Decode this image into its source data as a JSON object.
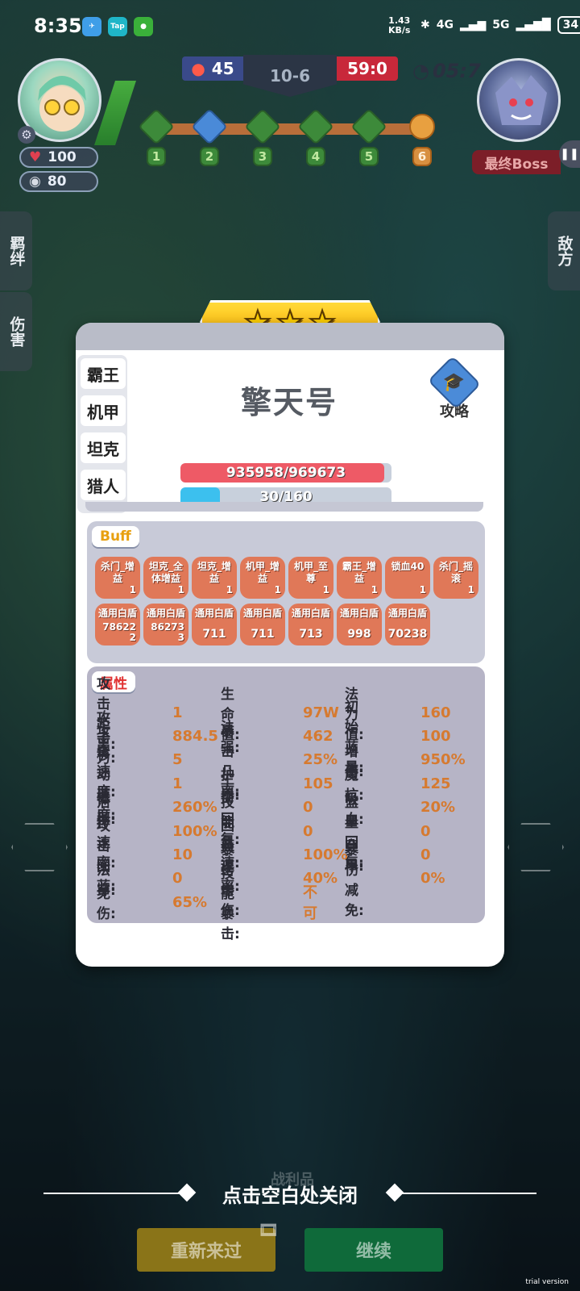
{
  "status_bar": {
    "time": "8:35",
    "net_speed_value": "1.43",
    "net_speed_unit": "KB/s",
    "signal_1": "4G",
    "signal_2": "5G",
    "battery": "34",
    "apps": [
      "telegram-icon",
      "taptap-icon",
      "green-app-icon"
    ]
  },
  "hud": {
    "player": {
      "hp": "100",
      "gold": "80"
    },
    "score_left": "45",
    "level": "10-6",
    "score_right": "59:0",
    "timer": "05:7",
    "stages": [
      "1",
      "2",
      "3",
      "4",
      "5",
      "6"
    ],
    "boss_label": "最终Boss",
    "side_left": [
      "羁绊",
      "伤害"
    ],
    "side_right": "敌方"
  },
  "panel": {
    "stars": 3,
    "tags": [
      "霸王",
      "机甲",
      "坦克",
      "猎人"
    ],
    "name": "擎天号",
    "guide_label": "攻略",
    "hp": {
      "text": "935958/969673",
      "fraction": 0.965,
      "color": "#ee5a66"
    },
    "mana": {
      "text": "30/160",
      "fraction": 0.1875,
      "color": "#3cc0ee"
    },
    "buff_title": "Buff",
    "buffs": [
      {
        "name": "杀门_增益",
        "count": "1"
      },
      {
        "name": "坦克_全体增益",
        "count": "1"
      },
      {
        "name": "坦克_增益",
        "count": "1"
      },
      {
        "name": "机甲_增益",
        "count": "1"
      },
      {
        "name": "机甲_至尊",
        "count": "1"
      },
      {
        "name": "霸王_增益",
        "count": "1"
      },
      {
        "name": "锁血40",
        "count": "1"
      },
      {
        "name": "杀门_摇滚",
        "count": "1"
      },
      {
        "name": "通用白盾",
        "count": "78622\n2"
      },
      {
        "name": "通用白盾",
        "count": "86273\n3"
      },
      {
        "name": "通用白盾",
        "count": "711"
      },
      {
        "name": "通用白盾",
        "count": "711"
      },
      {
        "name": "通用白盾",
        "count": "713"
      },
      {
        "name": "通用白盾",
        "count": "998"
      },
      {
        "name": "通用白盾",
        "count": "70238"
      }
    ],
    "attr_title": "属性",
    "attributes": [
      [
        {
          "label": "攻击距离:",
          "value": "1"
        },
        {
          "label": "生命值:",
          "value": "97W"
        },
        {
          "label": "法力值:",
          "value": "160"
        }
      ],
      [
        {
          "label": "攻击力:",
          "value": "884.5"
        },
        {
          "label": "法强:",
          "value": "462"
        },
        {
          "label": "初始蓝量:",
          "value": "100"
        }
      ],
      [
        {
          "label": "攻击速度:",
          "value": "5"
        },
        {
          "label": "暴击几率:",
          "value": "25%"
        },
        {
          "label": "增伤:",
          "value": "950%"
        }
      ],
      [
        {
          "label": "移动速度:",
          "value": "1"
        },
        {
          "label": "护甲:",
          "value": "105"
        },
        {
          "label": "魔抗:",
          "value": "125"
        }
      ],
      [
        {
          "label": "体型:",
          "value": "260%"
        },
        {
          "label": "生命回复:",
          "value": "0"
        },
        {
          "label": "吸血:",
          "value": "20%"
        }
      ],
      [
        {
          "label": "治疗速率:",
          "value": "100%"
        },
        {
          "label": "技能急速:",
          "value": "0"
        },
        {
          "label": "蓝量回复:",
          "value": "0"
        }
      ],
      [
        {
          "label": "攻击回蓝:",
          "value": "10"
        },
        {
          "label": "回蓝速率:",
          "value": "100%"
        },
        {
          "label": "穿甲:",
          "value": "0"
        }
      ],
      [
        {
          "label": "法穿:",
          "value": "0"
        },
        {
          "label": "暴击增伤:",
          "value": "40%"
        },
        {
          "label": "暴伤减免:",
          "value": "0%"
        }
      ],
      [
        {
          "label": "免伤:",
          "value": "65%"
        },
        {
          "label": "技能暴击:",
          "value": "不可"
        }
      ]
    ]
  },
  "bottom": {
    "ghost_text": "战利品",
    "close_hint": "点击空白处关闭",
    "retry_label": "重新来过",
    "continue_label": "继续",
    "trial_text": "trial version"
  }
}
